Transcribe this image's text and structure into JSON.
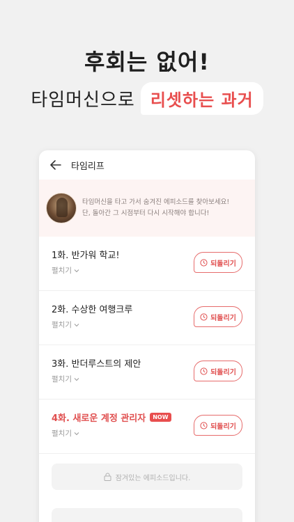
{
  "hero": {
    "title": "후회는 없어!",
    "subtitle_plain": "타임머신으로",
    "subtitle_highlight": "리셋하는 과거"
  },
  "screen": {
    "title": "타임리프",
    "notice_line1": "타임머신을 타고 가서 숨겨진 에피소드를 찾아보세요!",
    "notice_line2": "단, 돌아간 그 시점부터 다시 시작해야 합니다!"
  },
  "episodes": [
    {
      "title": "1화. 반가워 학교!",
      "expand": "펼치기",
      "action": "되돌리기"
    },
    {
      "title": "2화. 수상한 여행크루",
      "expand": "펼치기",
      "action": "되돌리기"
    },
    {
      "title": "3화. 반더루스트의 제안",
      "expand": "펼치기",
      "action": "되돌리기"
    },
    {
      "title": "4화. 새로운 계정 관리자",
      "badge": "NOW",
      "expand": "펼치기",
      "action": "되돌리기"
    }
  ],
  "locked": {
    "text": "잠겨있는 에피소드입니다."
  },
  "colors": {
    "accent": "#e84e4e",
    "notice_bg": "#fdf4f3",
    "page_bg": "#f1f1f1"
  },
  "icons": [
    "back-arrow-icon",
    "clock-icon",
    "chevron-down-icon",
    "lock-icon"
  ]
}
